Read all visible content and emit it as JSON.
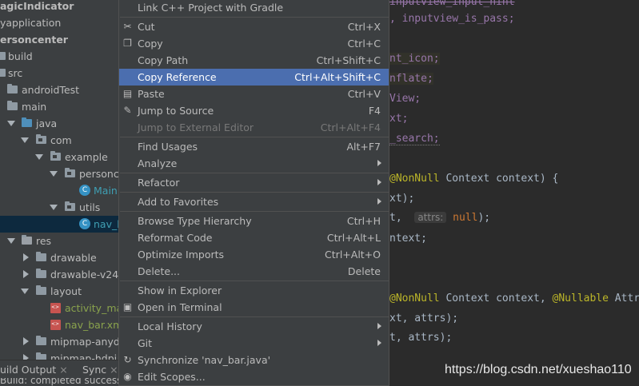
{
  "project_tree": {
    "items": [
      {
        "label": "agicIndicator",
        "bold": true
      },
      {
        "label": "yapplication",
        "bold": false
      },
      {
        "label": "ersoncenter",
        "bold": true
      },
      {
        "label": "build"
      },
      {
        "label": "src"
      },
      {
        "label": "androidTest"
      },
      {
        "label": "main"
      },
      {
        "label": "java"
      },
      {
        "label": "com"
      },
      {
        "label": "example"
      },
      {
        "label": "personc"
      },
      {
        "label": "Main"
      },
      {
        "label": "utils"
      },
      {
        "label": "nav_b"
      },
      {
        "label": "res"
      },
      {
        "label": "drawable"
      },
      {
        "label": "drawable-v24"
      },
      {
        "label": "layout"
      },
      {
        "label": "activity_mai"
      },
      {
        "label": "nav_bar.xm"
      },
      {
        "label": "mipmap-anydp"
      },
      {
        "label": "mipmap-hdpi"
      }
    ]
  },
  "bottom_bar": {
    "tab_build": "uild Output",
    "tab_build_close": "×",
    "tab_sync": "Sync",
    "tab_sync_close": "×",
    "status": "Build: completed successfully"
  },
  "context_menu": {
    "items": [
      {
        "label": "Link C++ Project with Gradle",
        "shortcut": "",
        "icon": ""
      },
      {
        "label": "Cut",
        "shortcut": "Ctrl+X",
        "icon": "scissors-icon"
      },
      {
        "label": "Copy",
        "shortcut": "Ctrl+C",
        "icon": "copy-icon"
      },
      {
        "label": "Copy Path",
        "shortcut": "Ctrl+Shift+C",
        "icon": ""
      },
      {
        "label": "Copy Reference",
        "shortcut": "Ctrl+Alt+Shift+C",
        "icon": "",
        "active": true
      },
      {
        "label": "Paste",
        "shortcut": "Ctrl+V",
        "icon": "paste-icon"
      },
      {
        "label": "Jump to Source",
        "shortcut": "F4",
        "icon": "pencil-icon"
      },
      {
        "label": "Jump to External Editor",
        "shortcut": "Ctrl+Alt+F4",
        "icon": "",
        "disabled": true
      },
      {
        "label": "Find Usages",
        "shortcut": "Alt+F7",
        "icon": ""
      },
      {
        "label": "Analyze",
        "shortcut": "",
        "icon": "",
        "submenu": true
      },
      {
        "label": "Refactor",
        "shortcut": "",
        "icon": "",
        "submenu": true
      },
      {
        "label": "Add to Favorites",
        "shortcut": "",
        "icon": "",
        "submenu": true
      },
      {
        "label": "Browse Type Hierarchy",
        "shortcut": "Ctrl+H",
        "icon": ""
      },
      {
        "label": "Reformat Code",
        "shortcut": "Ctrl+Alt+L",
        "icon": ""
      },
      {
        "label": "Optimize Imports",
        "shortcut": "Ctrl+Alt+O",
        "icon": ""
      },
      {
        "label": "Delete...",
        "shortcut": "Delete",
        "icon": ""
      },
      {
        "label": "Show in Explorer",
        "shortcut": "",
        "icon": ""
      },
      {
        "label": "Open in Terminal",
        "shortcut": "",
        "icon": "terminal-icon"
      },
      {
        "label": "Local History",
        "shortcut": "",
        "icon": "",
        "submenu": true
      },
      {
        "label": "Git",
        "shortcut": "",
        "icon": "",
        "submenu": true
      },
      {
        "label": "Synchronize 'nav_bar.java'",
        "shortcut": "",
        "icon": "sync-icon"
      },
      {
        "label": "Edit Scopes...",
        "shortcut": "",
        "icon": "scopes-icon"
      }
    ]
  },
  "editor": {
    "lines": [
      {
        "t": "inputview_input_hint",
        "cls": "fld strike"
      },
      {
        "t": ", inputview_is_pass;",
        "cls": "fld wavy"
      },
      {
        "t": "",
        "cls": ""
      },
      {
        "t": "nt_icon;",
        "cls": "fld hl"
      },
      {
        "t": "nflate;",
        "cls": "fld hl"
      },
      {
        "t": "View;",
        "cls": "fld"
      },
      {
        "t": "xt;",
        "cls": "fld"
      },
      {
        "t": "_search;",
        "cls": "fld wavy"
      },
      {
        "t": "",
        "cls": ""
      },
      {
        "t": "@NonNull Context context) {",
        "cls": "mix1"
      },
      {
        "t": "xt);",
        "cls": ""
      },
      {
        "t": "t,  attrs: null);",
        "cls": "mix2"
      },
      {
        "t": "ntext;",
        "cls": ""
      },
      {
        "t": "",
        "cls": ""
      },
      {
        "t": "",
        "cls": ""
      },
      {
        "t": "@NonNull Context context, @Nullable Attr",
        "cls": "mix3"
      },
      {
        "t": "xt, attrs);",
        "cls": ""
      },
      {
        "t": "t, attrs);",
        "cls": ""
      }
    ],
    "parts": {
      "nonnull": "@NonNull",
      "context_ctx": " Context context) {",
      "t_comma": "t,  ",
      "attrs_hint": "attrs:",
      "null": " null",
      "close": ");",
      "context_ctx2": " Context context, ",
      "nullable": "@Nullable",
      "attr_tail": " Attr"
    }
  },
  "watermark": "https://blog.csdn.net/xueshao110",
  "colors": {
    "menu_bg": "#3c3f41",
    "menu_active": "#4b6eaf",
    "editor_bg": "#2b2b2b",
    "tree_selected": "#0d293e"
  }
}
